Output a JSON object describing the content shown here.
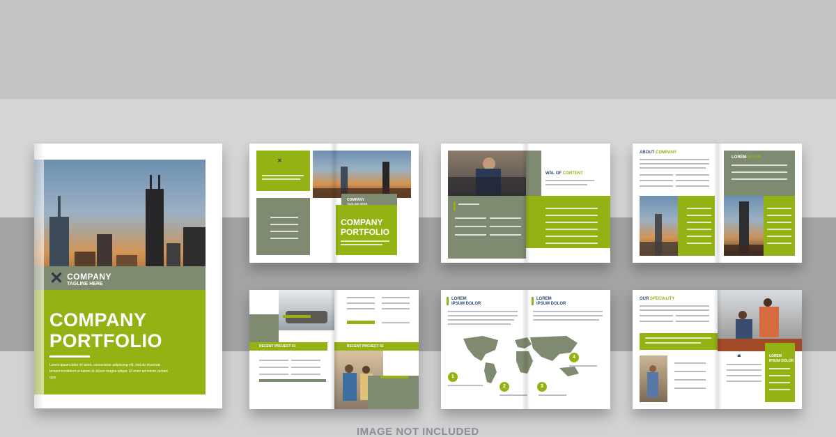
{
  "cover": {
    "company": "COMPANY",
    "tagline": "TAGLINE HERE",
    "title_line1": "COMPANY",
    "title_line2": "PORTFOLIO",
    "body": "Lorem ipsum dolor sit amet, consectetur adipiscing elit, sed do eiusmod tempor incididunt ut labore et dolore magna aliqua. Ut enim ad minim veniam quis"
  },
  "spread1": {
    "logo_text": "COMPANY",
    "logo_tagline": "TAGLINE HERE",
    "title_line1": "COMPANY",
    "title_line2": "PORTFOLIO"
  },
  "spread2": {
    "heading_a": "WAL OF ",
    "heading_b": "CONTENT"
  },
  "spread3": {
    "heading_a": "ABOUT ",
    "heading_b": "COMPANY",
    "side_heading_a": "LOREM ",
    "side_heading_b": "IPSUM"
  },
  "spread4": {
    "project_1": "RECENT PROJECT 01",
    "project_2": "RECENT PROJECT 01"
  },
  "spread5": {
    "heading_1": "LOREM",
    "heading_1b": "IPSUM DOLOR",
    "heading_2": "LOREM",
    "heading_2b": "IPSUM DOLOR",
    "markers": [
      "1",
      "2",
      "3",
      "4"
    ]
  },
  "spread6": {
    "heading_a": "OUR ",
    "heading_b": "SPECIALITY",
    "side_heading_1": "LOREM",
    "side_heading_2": "IPSUM DOLOR"
  },
  "footer": {
    "caption": "IMAGE NOT INCLUDED"
  },
  "colors": {
    "accent_green": "#93b315",
    "olive_gray": "#7f8b70",
    "navy": "#2b4b7a"
  }
}
